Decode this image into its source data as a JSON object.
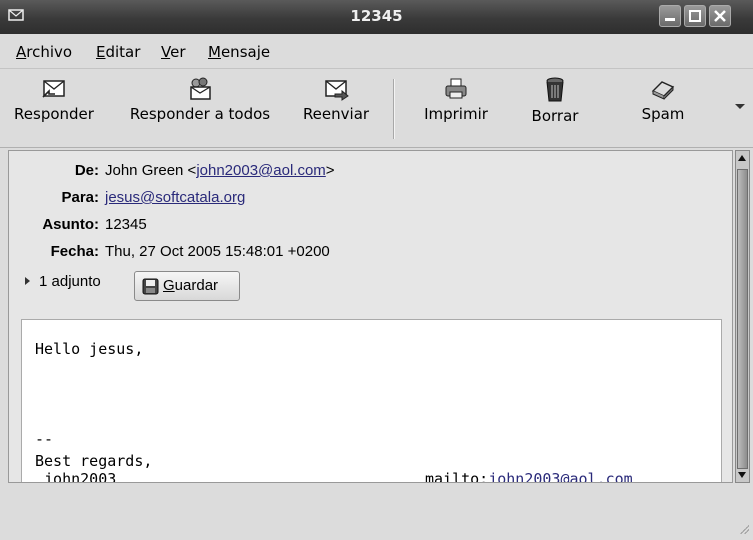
{
  "window": {
    "title": "12345"
  },
  "menu": [
    "Archivo",
    "Editar",
    "Ver",
    "Mensaje"
  ],
  "toolbar": {
    "reply": "Responder",
    "reply_all": "Responder a todos",
    "forward": "Reenviar",
    "print": "Imprimir",
    "delete": "Borrar",
    "spam": "Spam"
  },
  "headers": {
    "from_label": "De:",
    "from_name": "John Green <",
    "from_email": "john2003@aol.com",
    "from_tail": ">",
    "to_label": "Para:",
    "to_email": "jesus@softcatala.org",
    "subject_label": "Asunto:",
    "subject": "12345",
    "date_label": "Fecha:",
    "date": "Thu, 27 Oct 2005 15:48:01 +0200"
  },
  "attachment": {
    "count_label": "1 adjunto",
    "save_label": "Guardar"
  },
  "message": {
    "greeting": "Hello jesus,",
    "sig_sep": "--",
    "regards": "Best regards,",
    "signer": " john2003",
    "mailto_prefix": "mailto:",
    "mailto_email": "john2003@aol.com"
  }
}
